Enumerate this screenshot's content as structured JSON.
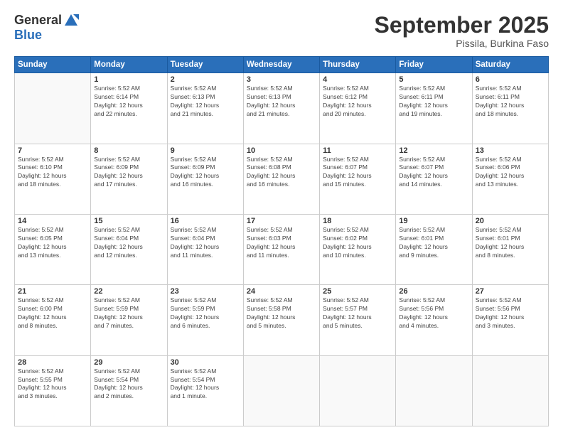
{
  "logo": {
    "general": "General",
    "blue": "Blue"
  },
  "header": {
    "month": "September 2025",
    "location": "Pissila, Burkina Faso"
  },
  "weekdays": [
    "Sunday",
    "Monday",
    "Tuesday",
    "Wednesday",
    "Thursday",
    "Friday",
    "Saturday"
  ],
  "weeks": [
    [
      {
        "day": "",
        "info": ""
      },
      {
        "day": "1",
        "info": "Sunrise: 5:52 AM\nSunset: 6:14 PM\nDaylight: 12 hours\nand 22 minutes."
      },
      {
        "day": "2",
        "info": "Sunrise: 5:52 AM\nSunset: 6:13 PM\nDaylight: 12 hours\nand 21 minutes."
      },
      {
        "day": "3",
        "info": "Sunrise: 5:52 AM\nSunset: 6:13 PM\nDaylight: 12 hours\nand 21 minutes."
      },
      {
        "day": "4",
        "info": "Sunrise: 5:52 AM\nSunset: 6:12 PM\nDaylight: 12 hours\nand 20 minutes."
      },
      {
        "day": "5",
        "info": "Sunrise: 5:52 AM\nSunset: 6:11 PM\nDaylight: 12 hours\nand 19 minutes."
      },
      {
        "day": "6",
        "info": "Sunrise: 5:52 AM\nSunset: 6:11 PM\nDaylight: 12 hours\nand 18 minutes."
      }
    ],
    [
      {
        "day": "7",
        "info": "Sunrise: 5:52 AM\nSunset: 6:10 PM\nDaylight: 12 hours\nand 18 minutes."
      },
      {
        "day": "8",
        "info": "Sunrise: 5:52 AM\nSunset: 6:09 PM\nDaylight: 12 hours\nand 17 minutes."
      },
      {
        "day": "9",
        "info": "Sunrise: 5:52 AM\nSunset: 6:09 PM\nDaylight: 12 hours\nand 16 minutes."
      },
      {
        "day": "10",
        "info": "Sunrise: 5:52 AM\nSunset: 6:08 PM\nDaylight: 12 hours\nand 16 minutes."
      },
      {
        "day": "11",
        "info": "Sunrise: 5:52 AM\nSunset: 6:07 PM\nDaylight: 12 hours\nand 15 minutes."
      },
      {
        "day": "12",
        "info": "Sunrise: 5:52 AM\nSunset: 6:07 PM\nDaylight: 12 hours\nand 14 minutes."
      },
      {
        "day": "13",
        "info": "Sunrise: 5:52 AM\nSunset: 6:06 PM\nDaylight: 12 hours\nand 13 minutes."
      }
    ],
    [
      {
        "day": "14",
        "info": "Sunrise: 5:52 AM\nSunset: 6:05 PM\nDaylight: 12 hours\nand 13 minutes."
      },
      {
        "day": "15",
        "info": "Sunrise: 5:52 AM\nSunset: 6:04 PM\nDaylight: 12 hours\nand 12 minutes."
      },
      {
        "day": "16",
        "info": "Sunrise: 5:52 AM\nSunset: 6:04 PM\nDaylight: 12 hours\nand 11 minutes."
      },
      {
        "day": "17",
        "info": "Sunrise: 5:52 AM\nSunset: 6:03 PM\nDaylight: 12 hours\nand 11 minutes."
      },
      {
        "day": "18",
        "info": "Sunrise: 5:52 AM\nSunset: 6:02 PM\nDaylight: 12 hours\nand 10 minutes."
      },
      {
        "day": "19",
        "info": "Sunrise: 5:52 AM\nSunset: 6:01 PM\nDaylight: 12 hours\nand 9 minutes."
      },
      {
        "day": "20",
        "info": "Sunrise: 5:52 AM\nSunset: 6:01 PM\nDaylight: 12 hours\nand 8 minutes."
      }
    ],
    [
      {
        "day": "21",
        "info": "Sunrise: 5:52 AM\nSunset: 6:00 PM\nDaylight: 12 hours\nand 8 minutes."
      },
      {
        "day": "22",
        "info": "Sunrise: 5:52 AM\nSunset: 5:59 PM\nDaylight: 12 hours\nand 7 minutes."
      },
      {
        "day": "23",
        "info": "Sunrise: 5:52 AM\nSunset: 5:59 PM\nDaylight: 12 hours\nand 6 minutes."
      },
      {
        "day": "24",
        "info": "Sunrise: 5:52 AM\nSunset: 5:58 PM\nDaylight: 12 hours\nand 5 minutes."
      },
      {
        "day": "25",
        "info": "Sunrise: 5:52 AM\nSunset: 5:57 PM\nDaylight: 12 hours\nand 5 minutes."
      },
      {
        "day": "26",
        "info": "Sunrise: 5:52 AM\nSunset: 5:56 PM\nDaylight: 12 hours\nand 4 minutes."
      },
      {
        "day": "27",
        "info": "Sunrise: 5:52 AM\nSunset: 5:56 PM\nDaylight: 12 hours\nand 3 minutes."
      }
    ],
    [
      {
        "day": "28",
        "info": "Sunrise: 5:52 AM\nSunset: 5:55 PM\nDaylight: 12 hours\nand 3 minutes."
      },
      {
        "day": "29",
        "info": "Sunrise: 5:52 AM\nSunset: 5:54 PM\nDaylight: 12 hours\nand 2 minutes."
      },
      {
        "day": "30",
        "info": "Sunrise: 5:52 AM\nSunset: 5:54 PM\nDaylight: 12 hours\nand 1 minute."
      },
      {
        "day": "",
        "info": ""
      },
      {
        "day": "",
        "info": ""
      },
      {
        "day": "",
        "info": ""
      },
      {
        "day": "",
        "info": ""
      }
    ]
  ]
}
